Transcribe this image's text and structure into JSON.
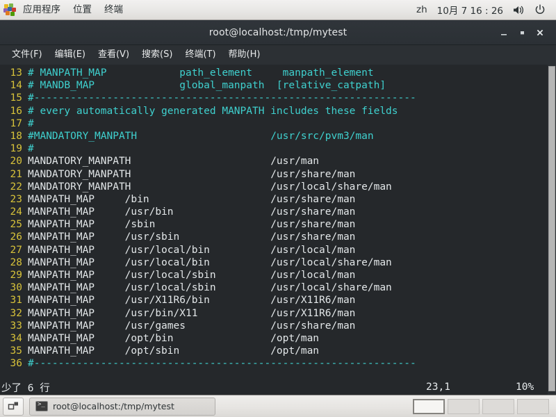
{
  "top_panel": {
    "apps_icon": "applications-grid-icon",
    "menus": [
      "应用程序",
      "位置",
      "终端"
    ],
    "keyboard_layout": "zh",
    "clock": "10月 7  16 : 26",
    "volume_icon": "volume-icon",
    "power_icon": "power-icon"
  },
  "window": {
    "title": "root@localhost:/tmp/mytest",
    "buttons": {
      "minimize": "minimize-icon",
      "maximize": "maximize-icon",
      "close": "close-icon"
    },
    "menubar": [
      "文件(F)",
      "编辑(E)",
      "查看(V)",
      "搜索(S)",
      "终端(T)",
      "帮助(H)"
    ]
  },
  "terminal": {
    "lines": [
      {
        "num": "13",
        "segments": [
          {
            "style": "cmt",
            "text": "# MANPATH_MAP            path_element     manpath_element"
          }
        ]
      },
      {
        "num": "14",
        "segments": [
          {
            "style": "cmt",
            "text": "# MANDB_MAP              global_manpath  [relative_catpath]"
          }
        ]
      },
      {
        "num": "15",
        "segments": [
          {
            "style": "cmt",
            "text": "#---------------------------------------------------------------"
          }
        ]
      },
      {
        "num": "16",
        "segments": [
          {
            "style": "cmt",
            "text": "# every automatically generated MANPATH includes these fields"
          }
        ]
      },
      {
        "num": "17",
        "segments": [
          {
            "style": "cmt",
            "text": "#"
          }
        ]
      },
      {
        "num": "18",
        "segments": [
          {
            "style": "cmt",
            "text": "#MANDATORY_MANPATH                      /usr/src/pvm3/man"
          }
        ]
      },
      {
        "num": "19",
        "segments": [
          {
            "style": "cmt",
            "text": "#"
          }
        ]
      },
      {
        "num": "20",
        "segments": [
          {
            "style": "txt",
            "text": "MANDATORY_MANPATH                       /usr/man"
          }
        ]
      },
      {
        "num": "21",
        "segments": [
          {
            "style": "txt",
            "text": "MANDATORY_MANPATH                       /usr/share/man"
          }
        ]
      },
      {
        "num": "22",
        "segments": [
          {
            "style": "txt",
            "text": "MANDATORY_MANPATH                       /usr/local/share/man"
          }
        ]
      },
      {
        "num": "23",
        "segments": [
          {
            "style": "txt",
            "text": "MANPATH_MAP     /bin                    /usr/share/man"
          }
        ]
      },
      {
        "num": "24",
        "segments": [
          {
            "style": "txt",
            "text": "MANPATH_MAP     /usr/bin                /usr/share/man"
          }
        ]
      },
      {
        "num": "25",
        "segments": [
          {
            "style": "txt",
            "text": "MANPATH_MAP     /sbin                   /usr/share/man"
          }
        ]
      },
      {
        "num": "26",
        "segments": [
          {
            "style": "txt",
            "text": "MANPATH_MAP     /usr/sbin               /usr/share/man"
          }
        ]
      },
      {
        "num": "27",
        "segments": [
          {
            "style": "txt",
            "text": "MANPATH_MAP     /usr/local/bin          /usr/local/man"
          }
        ]
      },
      {
        "num": "28",
        "segments": [
          {
            "style": "txt",
            "text": "MANPATH_MAP     /usr/local/bin          /usr/local/share/man"
          }
        ]
      },
      {
        "num": "29",
        "segments": [
          {
            "style": "txt",
            "text": "MANPATH_MAP     /usr/local/sbin         /usr/local/man"
          }
        ]
      },
      {
        "num": "30",
        "segments": [
          {
            "style": "txt",
            "text": "MANPATH_MAP     /usr/local/sbin         /usr/local/share/man"
          }
        ]
      },
      {
        "num": "31",
        "segments": [
          {
            "style": "txt",
            "text": "MANPATH_MAP     /usr/X11R6/bin          /usr/X11R6/man"
          }
        ]
      },
      {
        "num": "32",
        "segments": [
          {
            "style": "txt",
            "text": "MANPATH_MAP     /usr/bin/X11            /usr/X11R6/man"
          }
        ]
      },
      {
        "num": "33",
        "segments": [
          {
            "style": "txt",
            "text": "MANPATH_MAP     /usr/games              /usr/share/man"
          }
        ]
      },
      {
        "num": "34",
        "segments": [
          {
            "style": "txt",
            "text": "MANPATH_MAP     /opt/bin                /opt/man"
          }
        ]
      },
      {
        "num": "35",
        "segments": [
          {
            "style": "txt",
            "text": "MANPATH_MAP     /opt/sbin               /opt/man"
          }
        ]
      },
      {
        "num": "36",
        "segments": [
          {
            "style": "cmt",
            "text": "#---------------------------------------------------------------"
          }
        ]
      }
    ],
    "status": {
      "message": "少了 6 行",
      "position": "23,1",
      "percent": "10%"
    }
  },
  "taskbar": {
    "show_desktop_icon": "show-desktop-icon",
    "task_title": "root@localhost:/tmp/mytest",
    "task_icon": "terminal-icon",
    "workspaces": [
      {
        "label": "",
        "active": true
      },
      {
        "label": "",
        "active": false
      },
      {
        "label": "",
        "active": false
      },
      {
        "label": "",
        "active": false
      }
    ]
  },
  "colors": {
    "terminal_bg": "#25282b",
    "titlebar_bg": "#2c3034",
    "line_number": "#d7c23a",
    "comment": "#3fd1cf",
    "text": "#e3e7e9",
    "panel_bg": "#eceae7"
  }
}
